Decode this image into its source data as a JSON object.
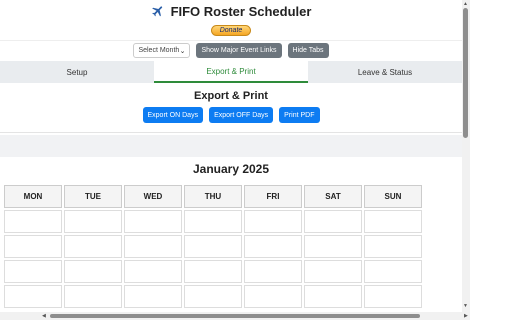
{
  "header": {
    "title": "FIFO Roster Scheduler",
    "icon": "airplane-icon",
    "donate_label": "Donate"
  },
  "controls": {
    "select_month": "Select Month",
    "major_events_label": "Show Major Event Links",
    "hide_tabs_label": "Hide Tabs"
  },
  "tabs": [
    {
      "label": "Setup"
    },
    {
      "label": "Export & Print",
      "active": true
    },
    {
      "label": "Leave & Status"
    }
  ],
  "export": {
    "title": "Export & Print",
    "buttons": [
      {
        "label": "Export ON Days"
      },
      {
        "label": "Export OFF Days"
      },
      {
        "label": "Print PDF"
      }
    ]
  },
  "calendar": {
    "month_title": "January 2025",
    "weekdays": [
      "MON",
      "TUE",
      "WED",
      "THU",
      "FRI",
      "SAT",
      "SUN"
    ]
  },
  "colors": {
    "accent_green": "#2e8b3a",
    "button_blue": "#0d7cf2",
    "button_gray": "#6c757d"
  }
}
